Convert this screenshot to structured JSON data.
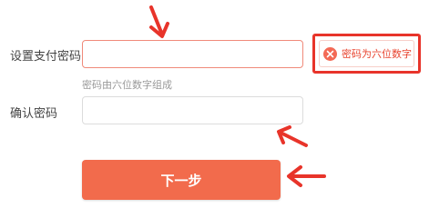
{
  "form": {
    "pay_password_label": "设置支付密码",
    "pay_password_value": "",
    "pay_password_hint": "密码由六位数字组成",
    "confirm_password_label": "确认密码",
    "confirm_password_value": "",
    "next_button_label": "下一步"
  },
  "error": {
    "message": "密码为六位数字",
    "icon": "close-circle-icon"
  },
  "colors": {
    "accent": "#f26b4c",
    "error": "#e8342a",
    "annotation": "#e8342a"
  }
}
